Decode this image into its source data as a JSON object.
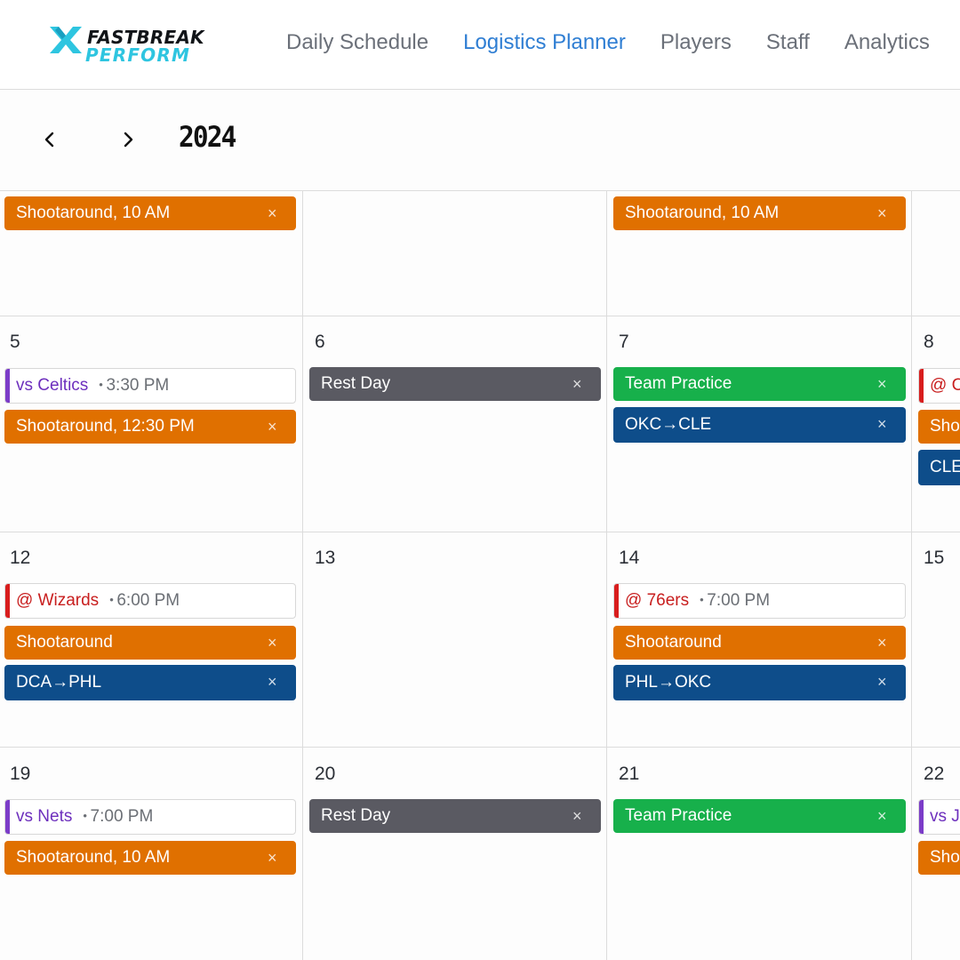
{
  "brand": {
    "name_top": "FASTBREAK",
    "name_bottom": "PERFORM",
    "accent": "#2ec5e0"
  },
  "nav": {
    "items": [
      {
        "label": "Daily Schedule",
        "active": false
      },
      {
        "label": "Logistics Planner",
        "active": true
      },
      {
        "label": "Players",
        "active": false
      },
      {
        "label": "Staff",
        "active": false
      },
      {
        "label": "Analytics",
        "active": false
      }
    ]
  },
  "toolbar": {
    "year": "2024",
    "prev_icon": "chevron-left-icon",
    "next_icon": "chevron-right-icon"
  },
  "calendar": {
    "colors": {
      "shootaround": "#e07000",
      "rest": "#5a5a62",
      "practice": "#17b04b",
      "travel": "#0e4d8a",
      "home": "#7b3cc8",
      "away": "#d81d1d"
    },
    "close_glyph": "×",
    "week0": {
      "c0": {
        "e0": "Shootaround, 10 AM"
      },
      "c2": {
        "e0": "Shootaround, 10 AM"
      }
    },
    "week1": {
      "c0": {
        "day": "5",
        "game": {
          "opp": "vs Celtics",
          "time": "3:30 PM"
        },
        "e1": "Shootaround, 12:30 PM"
      },
      "c1": {
        "day": "6",
        "e0": "Rest Day"
      },
      "c2": {
        "day": "7",
        "e0": "Team Practice",
        "e1": "OKC→CLE"
      },
      "c3": {
        "day": "8",
        "game": {
          "opp": "@ C",
          "time": ""
        },
        "e1": "Sho",
        "e2": "CLE"
      }
    },
    "week2": {
      "c0": {
        "day": "12",
        "game": {
          "opp": "@ Wizards",
          "time": "6:00 PM"
        },
        "e1": "Shootaround",
        "e2": "DCA→PHL"
      },
      "c1": {
        "day": "13"
      },
      "c2": {
        "day": "14",
        "game": {
          "opp": "@ 76ers",
          "time": "7:00 PM"
        },
        "e1": "Shootaround",
        "e2": "PHL→OKC"
      },
      "c3": {
        "day": "15"
      }
    },
    "week3": {
      "c0": {
        "day": "19",
        "game": {
          "opp": "vs Nets",
          "time": "7:00 PM"
        },
        "e1": "Shootaround, 10 AM"
      },
      "c1": {
        "day": "20",
        "e0": "Rest Day"
      },
      "c2": {
        "day": "21",
        "e0": "Team Practice"
      },
      "c3": {
        "day": "22",
        "game": {
          "opp": "vs J",
          "time": ""
        },
        "e1": "Sho"
      }
    }
  }
}
